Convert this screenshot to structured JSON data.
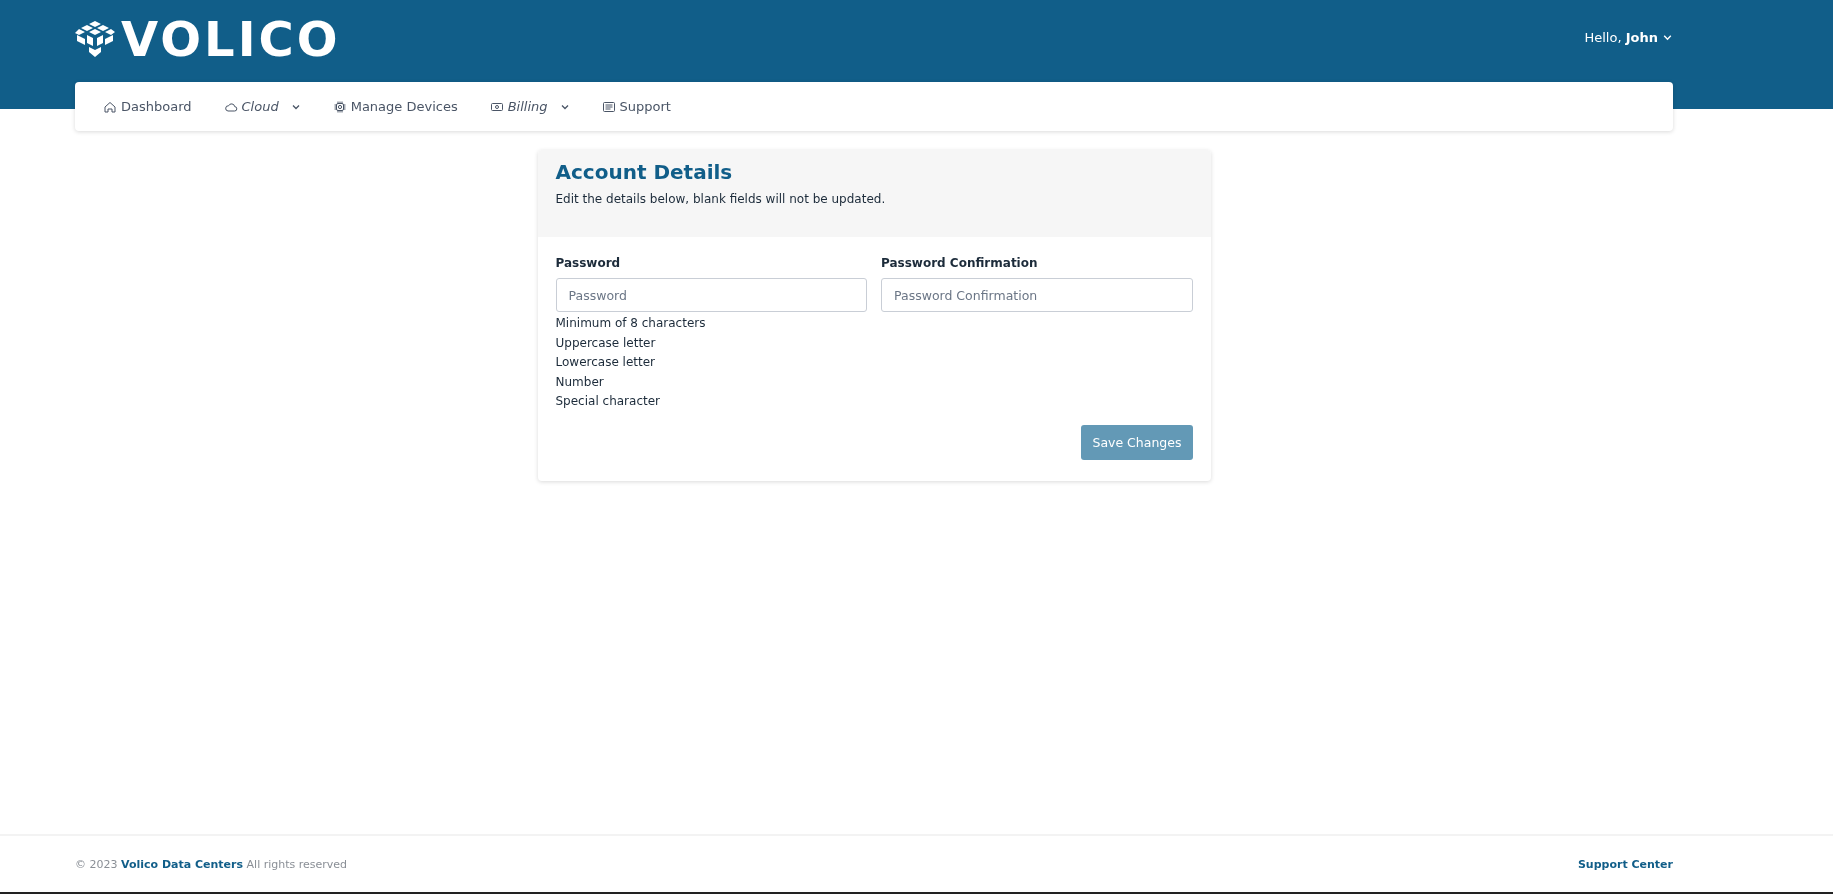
{
  "header": {
    "logo": "VOLICO",
    "greeting": "Hello,",
    "user": "John"
  },
  "nav": [
    {
      "label": "Dashboard",
      "kind": "home",
      "dropdown": false
    },
    {
      "label": "Cloud",
      "kind": "cloud",
      "dropdown": true
    },
    {
      "label": "Manage Devices",
      "kind": "devices",
      "dropdown": false
    },
    {
      "label": "Billing",
      "kind": "billing",
      "dropdown": true
    },
    {
      "label": "Support",
      "kind": "support",
      "dropdown": false
    }
  ],
  "card": {
    "title": "Account Details",
    "subtitle": "Edit the details below, blank fields will not be updated.",
    "fields": [
      {
        "label": "Password",
        "placeholder": "Password"
      },
      {
        "label": "Password Confirmation",
        "placeholder": "Password Confirmation"
      }
    ],
    "requirements": [
      "Minimum of 8 characters",
      "Uppercase letter",
      "Lowercase letter",
      "Number",
      "Special character"
    ],
    "button": {
      "label": "Save Changes",
      "disabled": true
    }
  },
  "footer": {
    "prefix": "© 2023",
    "company": "Volico Data Centers",
    "suffix": "All rights reserved",
    "link": "Support Center"
  }
}
